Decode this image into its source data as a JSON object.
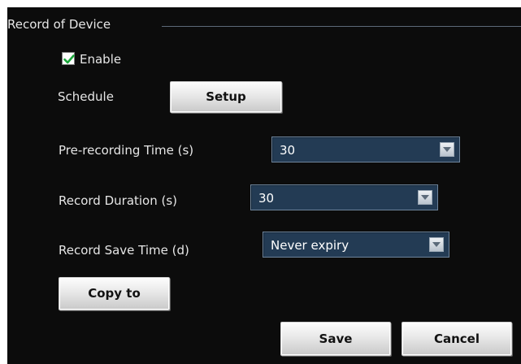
{
  "group": {
    "title": "Record of Device"
  },
  "enable": {
    "label": "Enable",
    "checked": true
  },
  "schedule": {
    "label": "Schedule",
    "button_label": "Setup"
  },
  "prerecord": {
    "label": "Pre-recording Time (s)",
    "value": "30"
  },
  "duration": {
    "label": "Record Duration (s)",
    "value": "30"
  },
  "save_time": {
    "label": "Record Save Time (d)",
    "value": "Never expiry"
  },
  "actions": {
    "copy_label": "Copy to",
    "save_label": "Save",
    "cancel_label": "Cancel"
  },
  "colors": {
    "panel_bg": "#0c0c0c",
    "select_bg": "#233b54",
    "check_green": "#1aa63a"
  }
}
